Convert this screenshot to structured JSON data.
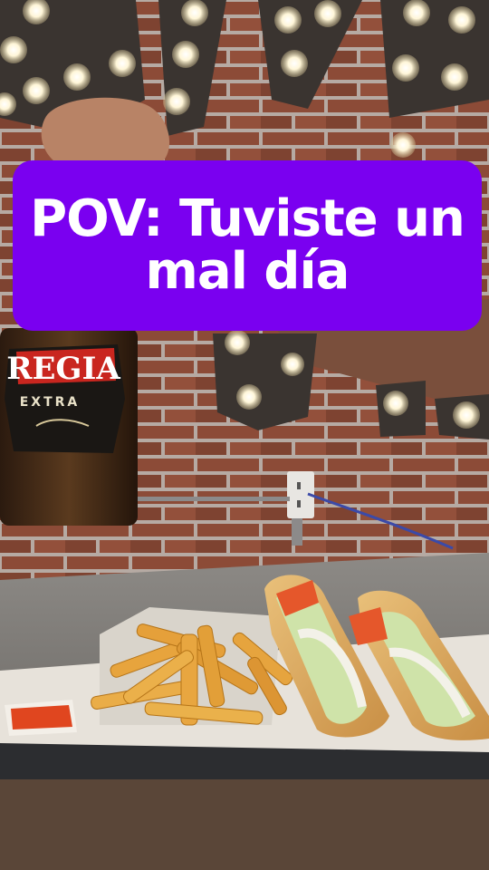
{
  "caption": {
    "text": "POV: Tuviste un mal día"
  },
  "bottle_label": {
    "brand": "REGIA",
    "sub": "EXTRA"
  },
  "colors": {
    "caption_bg": "#7a00f0",
    "caption_text": "#ffffff",
    "brick": "#8a4a36",
    "mortar": "#b9ada6"
  }
}
